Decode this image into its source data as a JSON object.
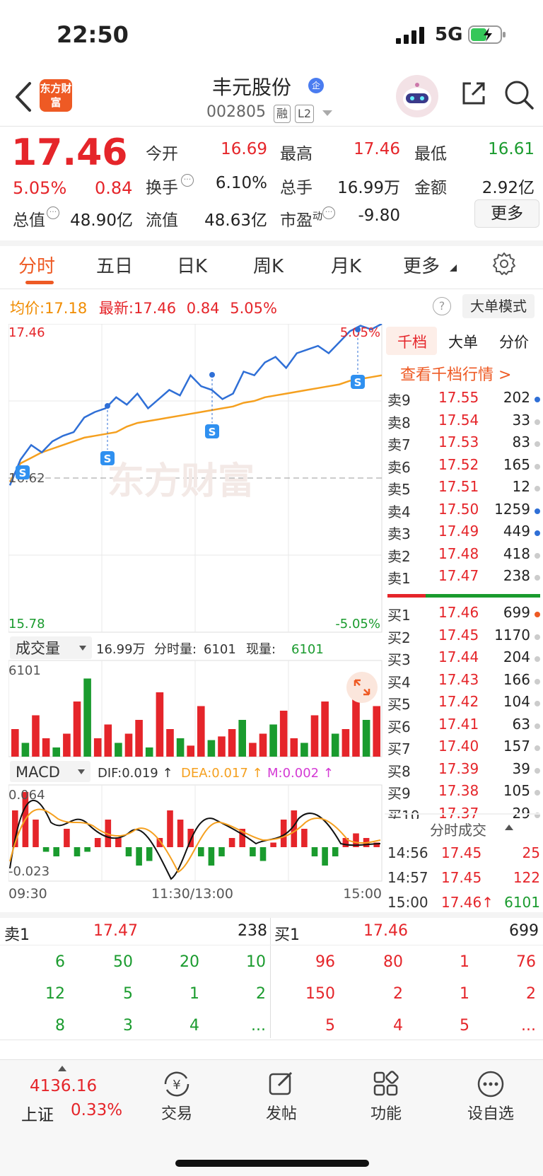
{
  "status_bar": {
    "time": "22:50",
    "network": "5G"
  },
  "header": {
    "logo_text": "东方财富",
    "stock_name": "丰元股份",
    "name_badge": "企",
    "stock_code": "002805",
    "tag_margin": "融",
    "tag_level": "L2"
  },
  "quote": {
    "price": "17.46",
    "change_pct": "5.05%",
    "change": "0.84",
    "open_label": "今开",
    "open": "16.69",
    "high_label": "最高",
    "high": "17.46",
    "low_label": "最低",
    "low": "16.61",
    "turnover_label": "换手",
    "turnover": "6.10%",
    "volume_label": "总手",
    "volume": "16.99万",
    "amount_label": "金额",
    "amount": "2.92亿",
    "mktcap_label": "总值",
    "mktcap": "48.90亿",
    "float_label": "流值",
    "float_cap": "48.63亿",
    "pe_label": "市盈",
    "pe_sup": "动",
    "pe": "-9.80",
    "more_button": "更多"
  },
  "tabs": [
    "分时",
    "五日",
    "日K",
    "周K",
    "月K",
    "更多"
  ],
  "chart_info": {
    "avg_label": "均价:",
    "avg": "17.18",
    "latest_label": "最新:",
    "latest": "17.46",
    "latest_chg": "0.84",
    "latest_pct": "5.05%",
    "help": "?",
    "big_order_mode": "大单模式"
  },
  "chart_data": {
    "type": "line",
    "x_ticks": [
      "09:30",
      "11:30/13:00",
      "15:00"
    ],
    "y_top_label": "17.46",
    "y_bottom_label": "15.78",
    "y_mid_label": "16.62",
    "pct_top_label": "5.05%",
    "pct_bottom_label": "-5.05%",
    "ylim": [
      15.78,
      17.46
    ],
    "series": [
      {
        "values": [
          16.58,
          16.72,
          16.8,
          16.76,
          16.82,
          16.85,
          16.87,
          16.95,
          16.98,
          17.0,
          17.06,
          17.02,
          17.08,
          17.0,
          17.05,
          17.1,
          17.07,
          17.18,
          17.12,
          17.1,
          17.05,
          17.08,
          17.2,
          17.18,
          17.25,
          17.28,
          17.22,
          17.3,
          17.32,
          17.34,
          17.3,
          17.36,
          17.42,
          17.45,
          17.43,
          17.46
        ]
      },
      {
        "values": [
          16.6,
          16.7,
          16.73,
          16.76,
          16.78,
          16.8,
          16.82,
          16.84,
          16.85,
          16.86,
          16.87,
          16.9,
          16.92,
          16.93,
          16.94,
          16.95,
          16.96,
          16.97,
          16.98,
          16.99,
          17.0,
          17.01,
          17.03,
          17.04,
          17.06,
          17.07,
          17.08,
          17.09,
          17.1,
          17.11,
          17.12,
          17.13,
          17.15,
          17.16,
          17.17,
          17.18
        ]
      }
    ],
    "volume_selector": "成交量",
    "volume_summary": "16.99万",
    "volume_minute_label": "分时量:",
    "volume_minute": "6101",
    "volume_now_label": "现量:",
    "volume_now": "6101",
    "volume_max": "6101",
    "volume_bars": [
      30,
      15,
      45,
      20,
      10,
      25,
      60,
      85,
      20,
      35,
      15,
      25,
      40,
      10,
      70,
      30,
      20,
      12,
      55,
      18,
      22,
      30,
      40,
      15,
      25,
      35,
      50,
      20,
      15,
      45,
      60,
      25,
      30,
      70,
      40,
      55
    ],
    "macd_selector": "MACD",
    "dif": "DIF:0.019 ↑",
    "dea": "DEA:0.017 ↑",
    "m": "M:0.002 ↑",
    "macd_top": "0.064",
    "macd_bottom": "-0.023",
    "macd_hist": [
      0.04,
      0.06,
      0.03,
      -0.005,
      -0.01,
      0.02,
      -0.01,
      -0.005,
      0.01,
      0.03,
      0.01,
      -0.01,
      -0.02,
      -0.015,
      0.01,
      0.04,
      0.03,
      0.02,
      -0.01,
      -0.02,
      -0.01,
      0.01,
      0.02,
      -0.01,
      -0.015,
      0.005,
      0.03,
      0.04,
      0.02,
      -0.01,
      -0.02,
      -0.01,
      0.01,
      0.015,
      0.01,
      0.005
    ]
  },
  "order_book": {
    "title": "千档",
    "tab_big": "大单",
    "tab_price": "分价",
    "view_all": "查看千档行情 >",
    "asks": [
      {
        "label": "卖9",
        "price": "17.55",
        "vol": "202"
      },
      {
        "label": "卖8",
        "price": "17.54",
        "vol": "33"
      },
      {
        "label": "卖7",
        "price": "17.53",
        "vol": "83"
      },
      {
        "label": "卖6",
        "price": "17.52",
        "vol": "165"
      },
      {
        "label": "卖5",
        "price": "17.51",
        "vol": "12"
      },
      {
        "label": "卖4",
        "price": "17.50",
        "vol": "1259"
      },
      {
        "label": "卖3",
        "price": "17.49",
        "vol": "449"
      },
      {
        "label": "卖2",
        "price": "17.48",
        "vol": "418"
      },
      {
        "label": "卖1",
        "price": "17.47",
        "vol": "238"
      }
    ],
    "bids": [
      {
        "label": "买1",
        "price": "17.46",
        "vol": "699"
      },
      {
        "label": "买2",
        "price": "17.45",
        "vol": "1170"
      },
      {
        "label": "买3",
        "price": "17.44",
        "vol": "204"
      },
      {
        "label": "买4",
        "price": "17.43",
        "vol": "166"
      },
      {
        "label": "买5",
        "price": "17.42",
        "vol": "104"
      },
      {
        "label": "买6",
        "price": "17.41",
        "vol": "63"
      },
      {
        "label": "买7",
        "price": "17.40",
        "vol": "157"
      },
      {
        "label": "买8",
        "price": "17.39",
        "vol": "39"
      },
      {
        "label": "买9",
        "price": "17.38",
        "vol": "105"
      },
      {
        "label": "买10",
        "price": "17.37",
        "vol": "29"
      }
    ],
    "ticks_title": "分时成交",
    "ticks": [
      {
        "time": "14:56",
        "price": "17.45",
        "vol": "25",
        "color": "#e5252a"
      },
      {
        "time": "14:57",
        "price": "17.45",
        "vol": "122",
        "color": "#e5252a"
      },
      {
        "time": "15:00",
        "price": "17.46↑",
        "vol": "6101",
        "color": "#1a9b2e"
      }
    ]
  },
  "queue": {
    "ask_label": "卖1",
    "ask_price": "17.47",
    "ask_vol": "238",
    "bid_label": "买1",
    "bid_price": "17.46",
    "bid_vol": "699",
    "ask_rows": [
      [
        "6",
        "50",
        "20",
        "10"
      ],
      [
        "12",
        "5",
        "1",
        "2"
      ],
      [
        "8",
        "3",
        "4",
        "..."
      ]
    ],
    "bid_rows": [
      [
        "96",
        "80",
        "1",
        "76"
      ],
      [
        "150",
        "2",
        "1",
        "2"
      ],
      [
        "5",
        "4",
        "5",
        "..."
      ]
    ]
  },
  "bottom_nav": {
    "index_value": "4136.16",
    "index_name": "上证",
    "index_pct": "0.33%",
    "trade": "交易",
    "post": "发帖",
    "function": "功能",
    "watchlist": "设自选"
  },
  "colors": {
    "up": "#e5252a",
    "down": "#1a9b2e",
    "accent": "#ee5a24",
    "price_line": "#2f6fd6",
    "avg_line": "#f5a01f"
  }
}
